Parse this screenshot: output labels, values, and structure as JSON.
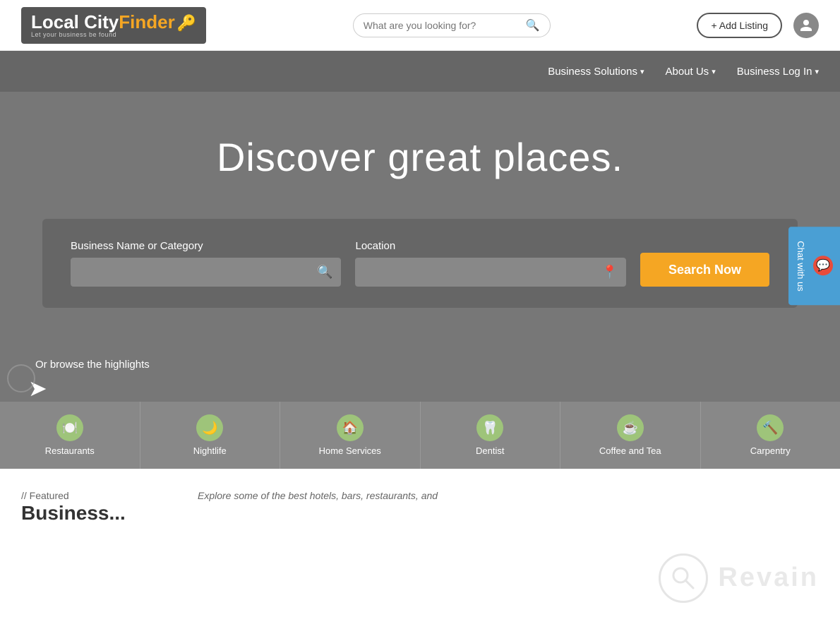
{
  "site": {
    "name_local": "Local",
    "name_city": "City",
    "name_finder": "Finder",
    "tagline": "Let your business be found"
  },
  "header": {
    "search_placeholder": "What are you looking for?",
    "add_listing_label": "+ Add Listing"
  },
  "nav": {
    "items": [
      {
        "id": "business-solutions",
        "label": "Business Solutions",
        "has_dropdown": true
      },
      {
        "id": "about-us",
        "label": "About Us",
        "has_dropdown": true
      },
      {
        "id": "business-login",
        "label": "Business Log In",
        "has_dropdown": true
      }
    ]
  },
  "hero": {
    "title": "Discover great places."
  },
  "search": {
    "category_label": "Business Name or Category",
    "category_placeholder": "",
    "location_label": "Location",
    "location_placeholder": "",
    "button_label": "Search Now"
  },
  "browse": {
    "label": "Or browse the highlights"
  },
  "categories": [
    {
      "id": "restaurants",
      "label": "Restaurants",
      "icon": "🍽️"
    },
    {
      "id": "nightlife",
      "label": "Nightlife",
      "icon": "🌙"
    },
    {
      "id": "home-services",
      "label": "Home Services",
      "icon": "🏠"
    },
    {
      "id": "dentist",
      "label": "Dentist",
      "icon": "🦷"
    },
    {
      "id": "coffee-tea",
      "label": "Coffee and Tea",
      "icon": "☕"
    },
    {
      "id": "carpentry",
      "label": "Carpentry",
      "icon": "🔨"
    }
  ],
  "featured": {
    "tag": "// Featured",
    "title": "Business...",
    "description": "Explore some of the best hotels, bars, restaurants, and"
  },
  "chat": {
    "label": "Chat with us"
  }
}
